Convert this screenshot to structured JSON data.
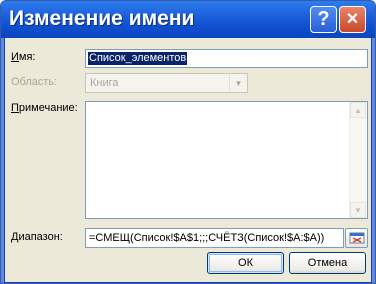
{
  "dialog": {
    "title": "Изменение имени",
    "help_icon": "?",
    "close_icon": "×"
  },
  "form": {
    "name_label_prefix": "И",
    "name_label_rest": "мя:",
    "name_value": "Список_элементов",
    "scope_label": "Область:",
    "scope_value": "Книга",
    "comment_label_prefix": "П",
    "comment_label_rest": "римечание:",
    "comment_value": "",
    "range_label_prefix": "Д",
    "range_label_rest": "иапазон:",
    "range_value": "=СМЕЩ(Список!$A$1;;;СЧЁТЗ(Список!$A:$A))"
  },
  "buttons": {
    "ok": "ОК",
    "cancel": "Отмена"
  },
  "icons": {
    "dropdown": "chevron-down-icon",
    "scroll_up": "scroll-up-arrow-icon",
    "scroll_down": "scroll-down-arrow-icon",
    "range_select": "collapse-dialog-icon"
  }
}
